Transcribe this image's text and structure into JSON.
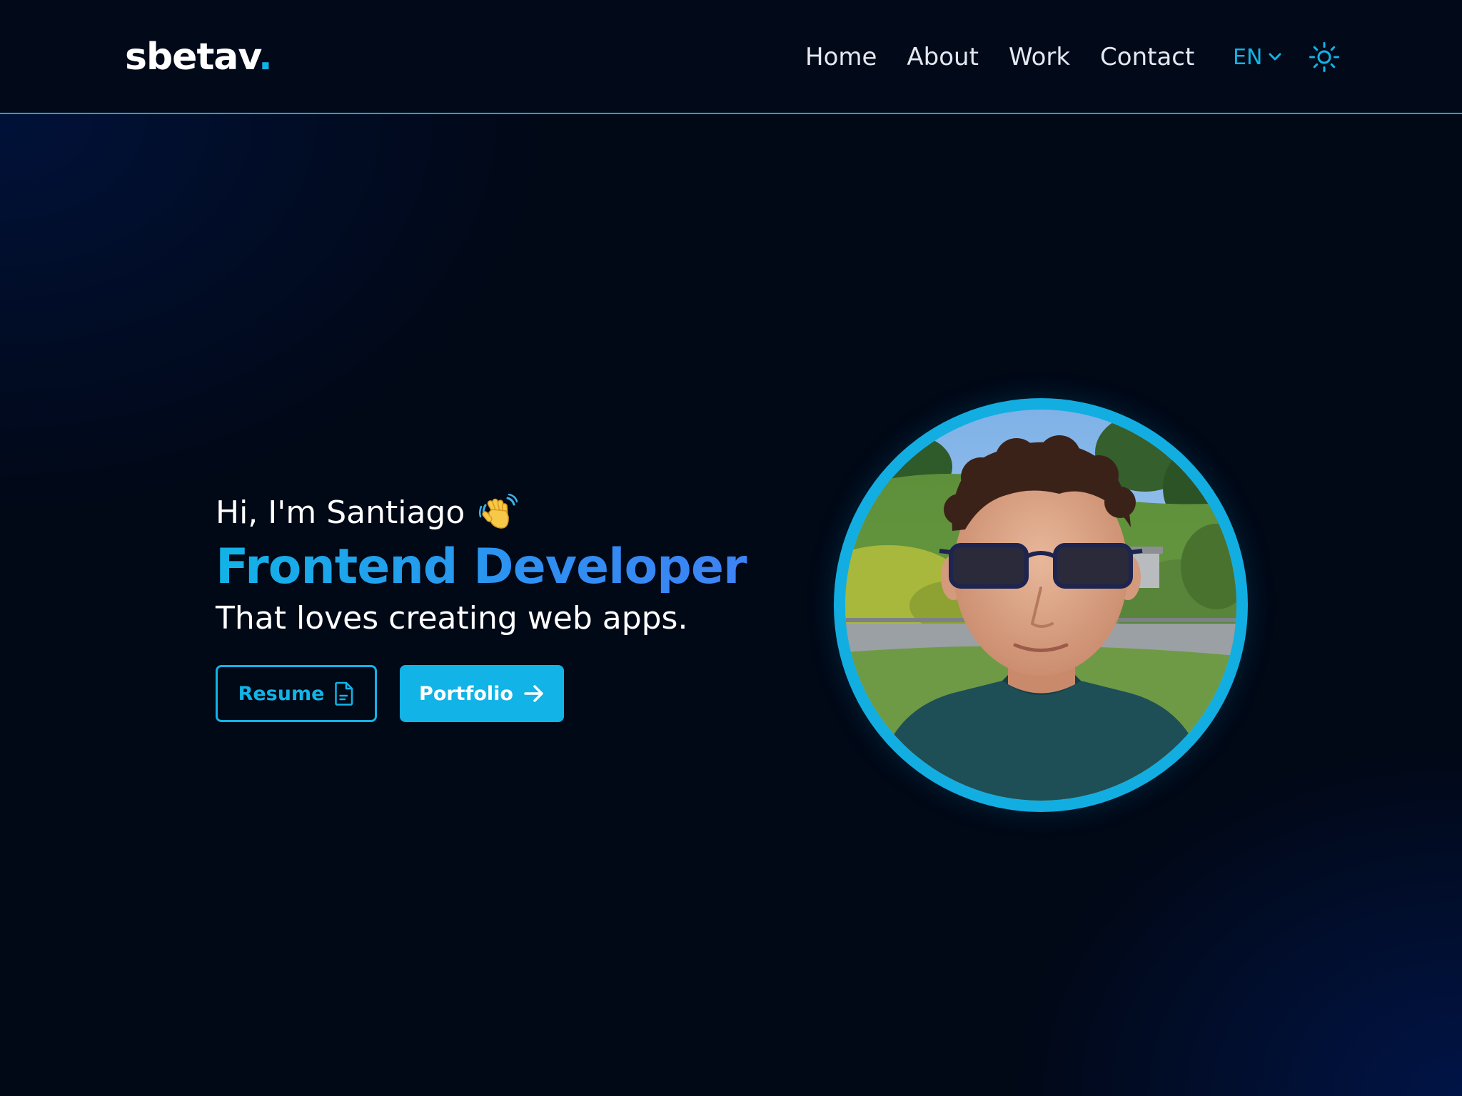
{
  "header": {
    "logo": {
      "text": "sbetav",
      "dot": "."
    },
    "nav": [
      {
        "label": "Home"
      },
      {
        "label": "About"
      },
      {
        "label": "Work"
      },
      {
        "label": "Contact"
      }
    ],
    "language": {
      "selected": "EN",
      "icon": "chevron-down-icon"
    },
    "theme_toggle": {
      "icon": "sun-icon"
    }
  },
  "hero": {
    "greeting": "Hi, I'm Santiago",
    "greeting_emoji": "waving-hand-icon",
    "role": "Frontend Developer",
    "tagline": "That loves creating web apps.",
    "buttons": {
      "resume": {
        "label": "Resume",
        "icon": "document-icon"
      },
      "portfolio": {
        "label": "Portfolio",
        "icon": "arrow-right-icon"
      }
    },
    "photo": {
      "alt": "Santiago"
    }
  },
  "colors": {
    "background": "#010816",
    "header_background": "#020a1a",
    "accent": "#12b3e6",
    "accent_gradient_end": "#3f82f5",
    "text": "#ffffff"
  }
}
